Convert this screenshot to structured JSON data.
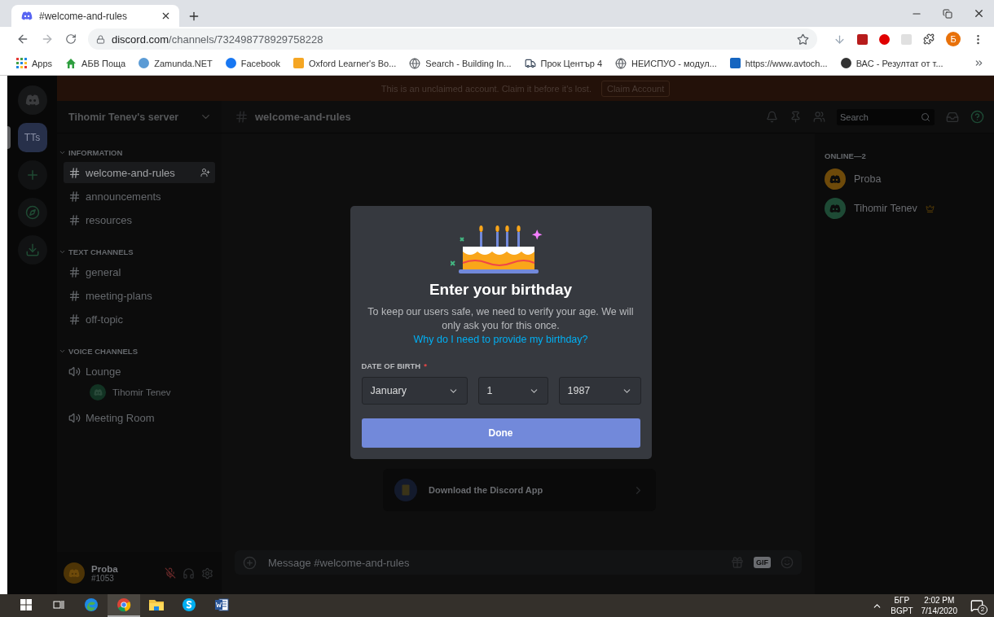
{
  "browser": {
    "tab": {
      "title": "#welcome-and-rules"
    },
    "address": {
      "domain": "discord.com",
      "path": "/channels/732498778929758228"
    },
    "profile": "Б",
    "bookmarks": [
      {
        "label": "Apps",
        "kind": "apps"
      },
      {
        "label": "АБВ Поща",
        "kind": "home",
        "color": "#2e9e3e"
      },
      {
        "label": "Zamunda.NET",
        "kind": "dot",
        "color": "#5b9bd5"
      },
      {
        "label": "Facebook",
        "kind": "dot",
        "color": "#1877f2"
      },
      {
        "label": "Oxford Learner's Bo...",
        "kind": "square",
        "color": "#f5a623"
      },
      {
        "label": "Search - Building In...",
        "kind": "globe",
        "color": "#5f6368"
      },
      {
        "label": "Прок Център 4",
        "kind": "truck",
        "color": "#3c4a5c"
      },
      {
        "label": "НЕИСПУО - модул...",
        "kind": "globe",
        "color": "#5f6368"
      },
      {
        "label": "https://www.avtoch...",
        "kind": "square",
        "color": "#1565c0"
      },
      {
        "label": "ВАС - Резултат от т...",
        "kind": "dot",
        "color": "#333333"
      }
    ]
  },
  "discord": {
    "banner": {
      "text": "This is an unclaimed account. Claim it before it's lost.",
      "button": "Claim Account"
    },
    "rail": [
      {
        "kind": "home",
        "selected": false
      },
      {
        "kind": "server",
        "label": "TTs",
        "selected": true
      },
      {
        "kind": "add",
        "selected": false
      },
      {
        "kind": "explore",
        "selected": false
      },
      {
        "kind": "download",
        "selected": false
      }
    ],
    "server_name": "Tihomir Tenev's server",
    "categories": [
      {
        "name": "INFORMATION",
        "kind": "text",
        "channels": [
          {
            "name": "welcome-and-rules",
            "selected": true
          },
          {
            "name": "announcements",
            "selected": false
          },
          {
            "name": "resources",
            "selected": false
          }
        ]
      },
      {
        "name": "TEXT CHANNELS",
        "kind": "text",
        "channels": [
          {
            "name": "general",
            "selected": false
          },
          {
            "name": "meeting-plans",
            "selected": false
          },
          {
            "name": "off-topic",
            "selected": false
          }
        ]
      },
      {
        "name": "VOICE CHANNELS",
        "kind": "voice",
        "channels": [
          {
            "name": "Lounge",
            "selected": false,
            "children": [
              {
                "name": "Tihomir Tenev"
              }
            ]
          },
          {
            "name": "Meeting Room",
            "selected": false
          }
        ]
      }
    ],
    "user": {
      "name": "Proba",
      "tag": "#1053",
      "muted": true
    },
    "channel_title": "welcome-and-rules",
    "search": {
      "placeholder": "Search"
    },
    "members": {
      "heading": "ONLINE—2",
      "list": [
        {
          "name": "Proba",
          "color": "#6e4a0a",
          "owner": false
        },
        {
          "name": "Tihomir Tenev",
          "color": "#1e4a35",
          "owner": true
        }
      ]
    },
    "download_card": {
      "text": "Download the Discord App"
    },
    "message": {
      "placeholder": "Message #welcome-and-rules",
      "gif_label": "GIF"
    },
    "modal": {
      "title": "Enter your birthday",
      "body": "To keep our users safe, we need to verify your age. We will only ask you for this once.",
      "link": "Why do I need to provide my birthday?",
      "label": "DATE OF BIRTH",
      "required_mark": "*",
      "fields": [
        {
          "value": "January"
        },
        {
          "value": "1"
        },
        {
          "value": "1987"
        }
      ],
      "button": "Done"
    }
  },
  "taskbar": {
    "apps": [
      {
        "kind": "edge",
        "selected": false
      },
      {
        "kind": "chrome",
        "selected": true
      },
      {
        "kind": "folder",
        "selected": false
      },
      {
        "kind": "skype",
        "selected": false
      },
      {
        "kind": "word",
        "selected": false
      }
    ],
    "language": [
      "БГР",
      "BGPT"
    ],
    "time": "2:02 PM",
    "date": "7/14/2020",
    "notifications": "2"
  }
}
